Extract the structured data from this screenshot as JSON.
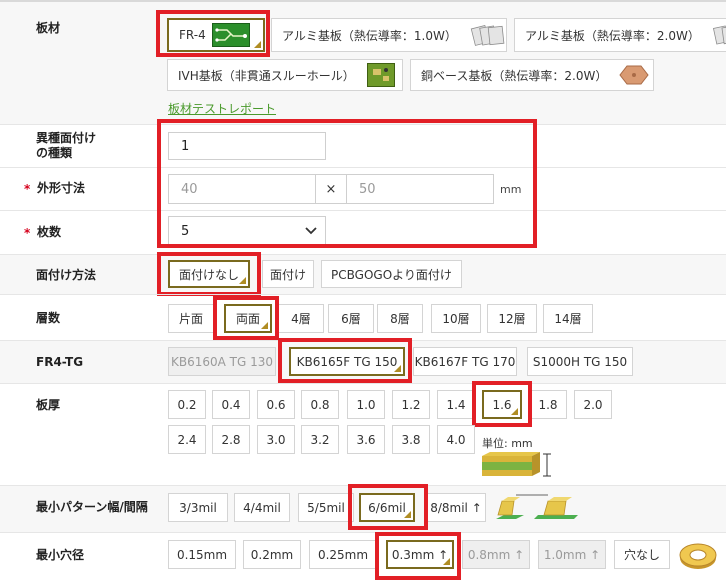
{
  "board_material": {
    "label": "板材",
    "options": [
      "FR-4",
      "アルミ基板（熱伝導率：1.0W）",
      "アルミ基板（熱伝導率：2.0W）",
      "IVH基板（非貫通スルーホール）",
      "銅ベース基板（熱伝導率：2.0W）"
    ],
    "selected": "FR-4",
    "test_report_link": "板材テストレポート"
  },
  "mixed_assembly": {
    "label_line1": "異種面付け",
    "label_line2": "の種類",
    "value": "1"
  },
  "dimensions": {
    "label": "外形寸法",
    "required_mark": "*",
    "width_placeholder": "40",
    "separator": "×",
    "height_placeholder": "50",
    "unit": "mm"
  },
  "quantity": {
    "label": "枚数",
    "required_mark": "*",
    "value": "5"
  },
  "panelize": {
    "label": "面付け方法",
    "options": [
      "面付けなし",
      "面付け",
      "PCBGOGOより面付け"
    ],
    "selected": "面付けなし"
  },
  "layers": {
    "label": "層数",
    "options": [
      "片面",
      "両面",
      "4層",
      "6層",
      "8層",
      "10層",
      "12層",
      "14層"
    ],
    "selected": "両面"
  },
  "fr4_tg": {
    "label": "FR4-TG",
    "options": [
      "KB6160A TG 130",
      "KB6165F TG 150",
      "KB6167F TG 170",
      "S1000H TG 150"
    ],
    "selected": "KB6165F TG 150",
    "disabled": [
      "KB6160A TG 130"
    ]
  },
  "thickness": {
    "label": "板厚",
    "row1": [
      "0.2",
      "0.4",
      "0.6",
      "0.8",
      "1.0",
      "1.2",
      "1.4",
      "1.6",
      "1.8",
      "2.0"
    ],
    "row2": [
      "2.4",
      "2.8",
      "3.0",
      "3.2",
      "3.6",
      "3.8",
      "4.0"
    ],
    "selected": "1.6",
    "unit": "単位: mm"
  },
  "min_trace": {
    "label": "最小パターン幅/間隔",
    "options": [
      "3/3mil",
      "4/4mil",
      "5/5mil",
      "6/6mil",
      "8/8mil ↑"
    ],
    "selected": "6/6mil"
  },
  "min_hole": {
    "label": "最小穴径",
    "options": [
      "0.15mm",
      "0.2mm",
      "0.25mm",
      "0.3mm ↑",
      "0.8mm ↑",
      "1.0mm ↑",
      "穴なし"
    ],
    "selected": "0.3mm ↑",
    "disabled": [
      "0.8mm ↑",
      "1.0mm ↑"
    ]
  },
  "colors": {
    "highlight": "#e21f26",
    "selected_border": "#7a6a1e",
    "link": "#4a9a2c",
    "required": "#d6001c"
  }
}
